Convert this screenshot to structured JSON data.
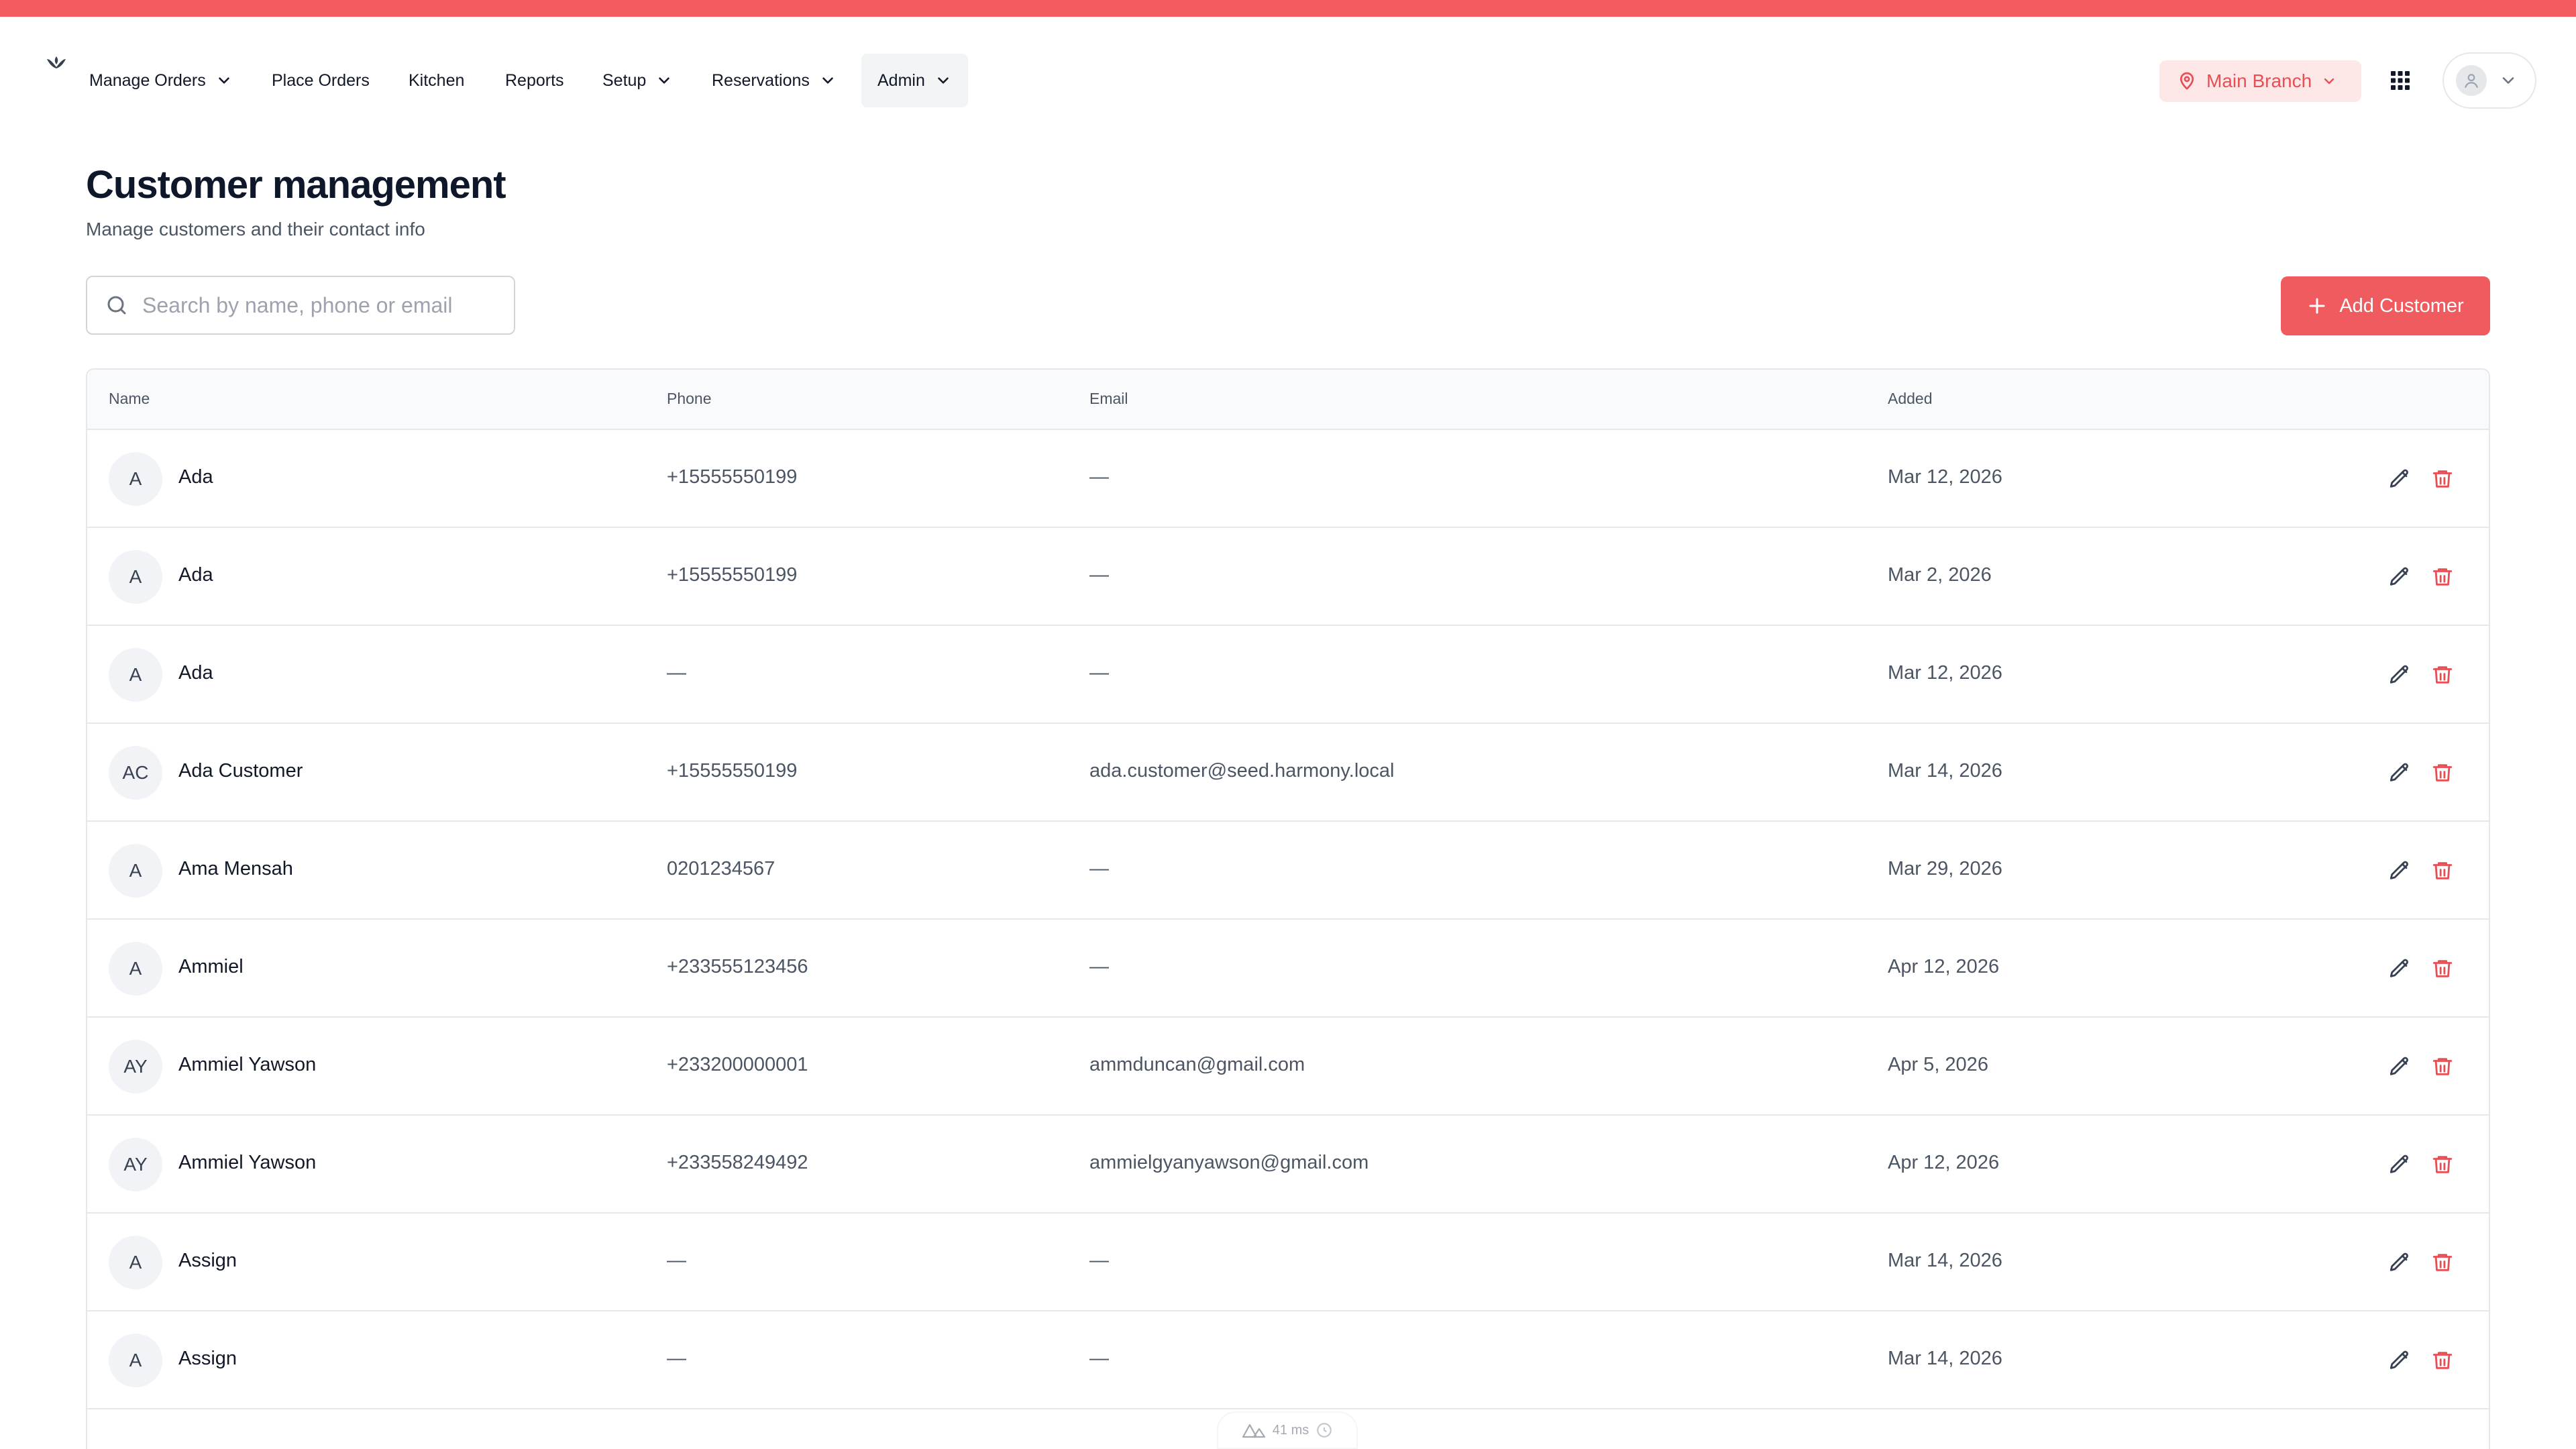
{
  "nav": {
    "items": [
      {
        "label": "Manage Orders",
        "dropdown": true
      },
      {
        "label": "Place Orders",
        "dropdown": false
      },
      {
        "label": "Kitchen",
        "dropdown": false
      },
      {
        "label": "Reports",
        "dropdown": false
      },
      {
        "label": "Setup",
        "dropdown": true
      },
      {
        "label": "Reservations",
        "dropdown": true
      },
      {
        "label": "Admin",
        "dropdown": true,
        "active": true
      }
    ],
    "branch_label": "Main Branch",
    "icons": {
      "logo": "leaf-logo-icon",
      "branch": "map-pin-icon",
      "apps": "grid-icon",
      "user": "user-icon"
    }
  },
  "page": {
    "title": "Customer management",
    "subtitle": "Manage customers and their contact info",
    "search_placeholder": "Search by name, phone or email",
    "search_value": "",
    "add_button_label": "Add Customer"
  },
  "table": {
    "headers": {
      "name": "Name",
      "phone": "Phone",
      "email": "Email",
      "added": "Added"
    },
    "rows": [
      {
        "initials": "A",
        "name": "Ada",
        "phone": "+15555550199",
        "email": "—",
        "added": "Mar 12, 2026"
      },
      {
        "initials": "A",
        "name": "Ada",
        "phone": "+15555550199",
        "email": "—",
        "added": "Mar 2, 2026"
      },
      {
        "initials": "A",
        "name": "Ada",
        "phone": "—",
        "email": "—",
        "added": "Mar 12, 2026"
      },
      {
        "initials": "AC",
        "name": "Ada Customer",
        "phone": "+15555550199",
        "email": "ada.customer@seed.harmony.local",
        "added": "Mar 14, 2026"
      },
      {
        "initials": "A",
        "name": "Ama Mensah",
        "phone": "0201234567",
        "email": "—",
        "added": "Mar 29, 2026"
      },
      {
        "initials": "A",
        "name": "Ammiel",
        "phone": "+233555123456",
        "email": "—",
        "added": "Apr 12, 2026"
      },
      {
        "initials": "AY",
        "name": "Ammiel Yawson",
        "phone": "+233200000001",
        "email": "ammduncan@gmail.com",
        "added": "Apr 5, 2026"
      },
      {
        "initials": "AY",
        "name": "Ammiel Yawson",
        "phone": "+233558249492",
        "email": "ammielgyanyawson@gmail.com",
        "added": "Apr 12, 2026"
      },
      {
        "initials": "A",
        "name": "Assign",
        "phone": "—",
        "email": "—",
        "added": "Mar 14, 2026"
      },
      {
        "initials": "A",
        "name": "Assign",
        "phone": "—",
        "email": "—",
        "added": "Mar 14, 2026"
      }
    ],
    "row_action_icons": [
      "pencil-icon",
      "trash-icon"
    ],
    "colors": {
      "accent": "#ef5b5e",
      "delete": "#e84f55"
    }
  },
  "dev_badge": {
    "label": "41 ms"
  }
}
